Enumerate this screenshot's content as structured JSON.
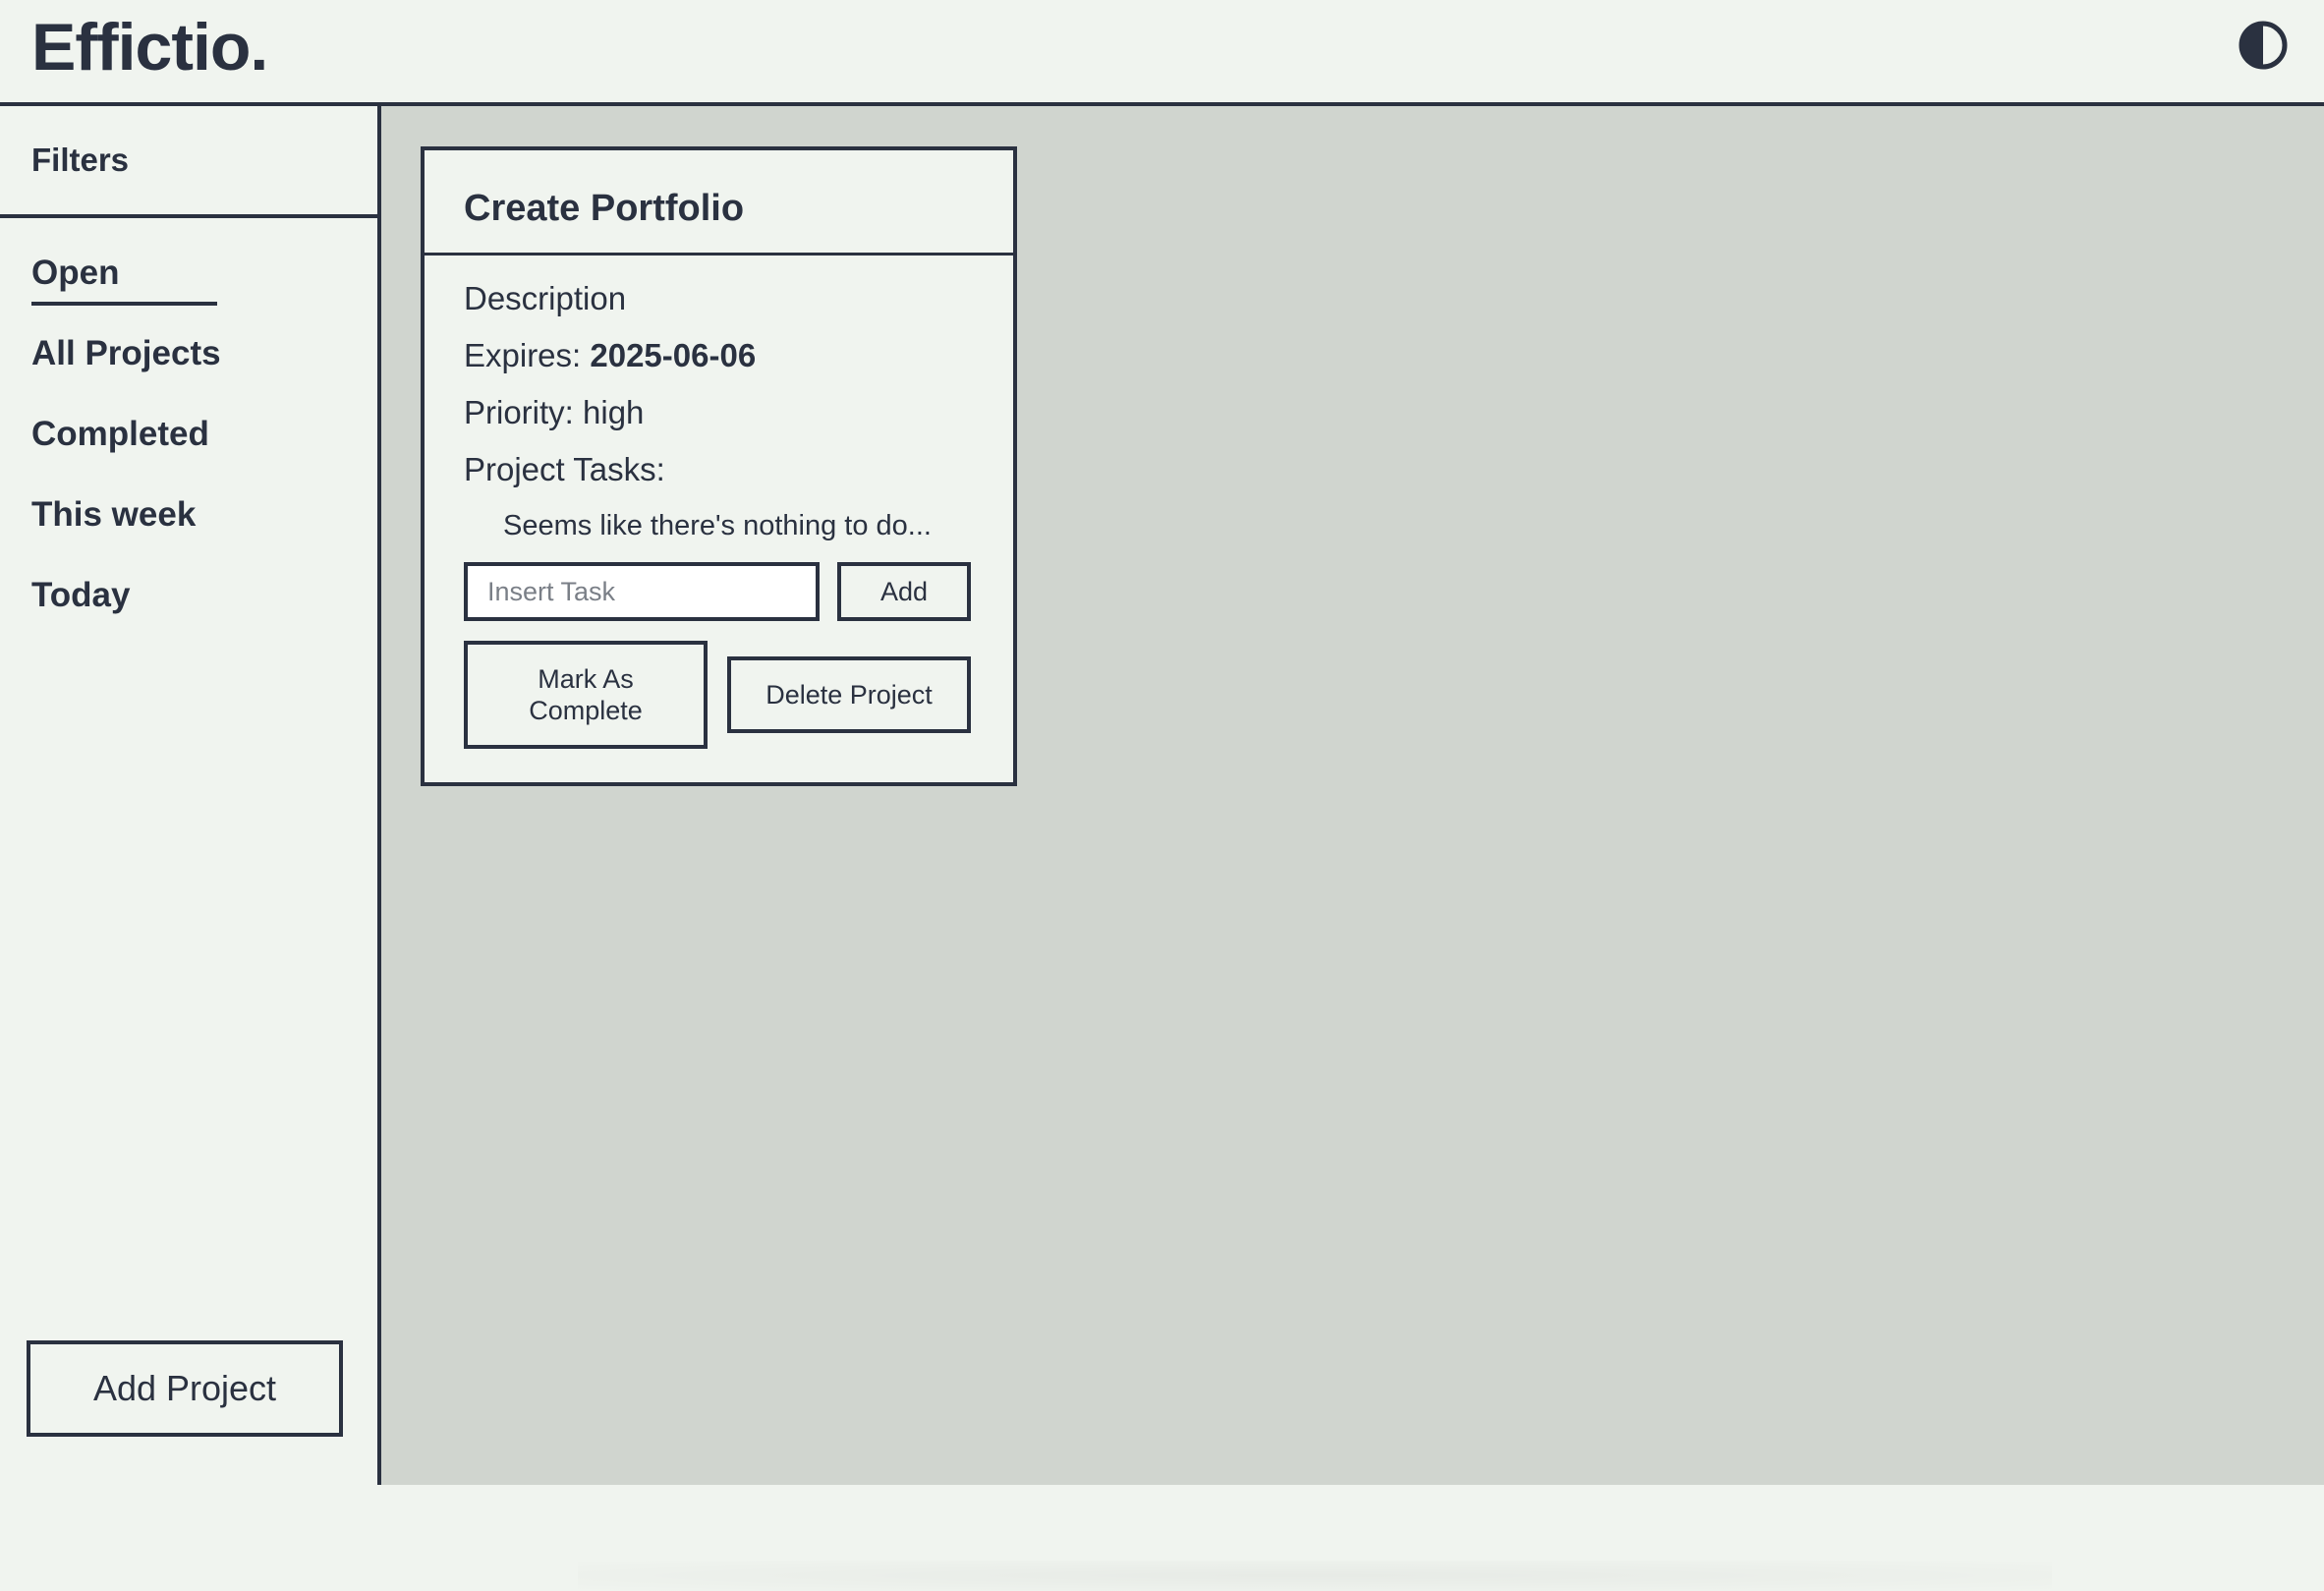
{
  "header": {
    "logo": "Effictio.",
    "theme_toggle_icon": "contrast-icon"
  },
  "sidebar": {
    "filters_title": "Filters",
    "items": [
      {
        "label": "Open",
        "active": true
      },
      {
        "label": "All Projects",
        "active": false
      },
      {
        "label": "Completed",
        "active": false
      },
      {
        "label": "This week",
        "active": false
      },
      {
        "label": "Today",
        "active": false
      }
    ],
    "add_project_label": "Add Project"
  },
  "card": {
    "title": "Create Portfolio",
    "description": "Description",
    "expires_label": "Expires: ",
    "expires_value": "2025-06-06",
    "priority": "Priority: high",
    "tasks_label": "Project Tasks:",
    "empty_message": "Seems like there's nothing to do...",
    "task_input_placeholder": "Insert Task",
    "add_label": "Add",
    "complete_label": "Mark As Complete",
    "delete_label": "Delete Project"
  },
  "colors": {
    "ink": "#2a3140",
    "panel": "#f0f4ef",
    "canvas": "#d0d5cf"
  }
}
